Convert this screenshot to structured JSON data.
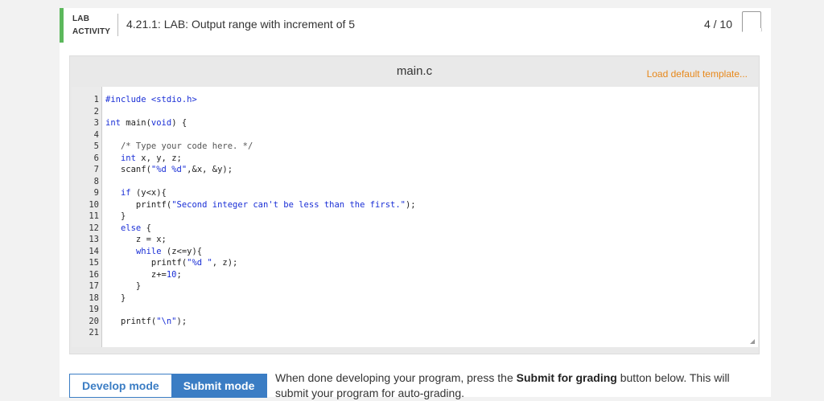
{
  "header": {
    "activity_line1": "LAB",
    "activity_line2": "ACTIVITY",
    "title": "4.21.1: LAB: Output range with increment of 5",
    "score": "4 / 10"
  },
  "editor": {
    "file_name": "main.c",
    "load_template": "Load default template...",
    "line_numbers": [
      "1",
      "2",
      "3",
      "4",
      "5",
      "6",
      "7",
      "8",
      "9",
      "10",
      "11",
      "12",
      "13",
      "14",
      "15",
      "16",
      "17",
      "18",
      "19",
      "20",
      "21"
    ],
    "lines": {
      "l1": "#include <stdio.h>",
      "l3a": "int",
      "l3b": " main(",
      "l3c": "void",
      "l3d": ") {",
      "l5": "   /* Type your code here. */",
      "l6a": "   ",
      "l6b": "int",
      "l6c": " x, y, z;",
      "l7a": "   scanf(",
      "l7b": "\"%d %d\"",
      "l7c": ",&x, &y);",
      "l9a": "   ",
      "l9b": "if",
      "l9c": " (y<x){",
      "l10a": "      printf(",
      "l10b": "\"Second integer can't be less than the first.\"",
      "l10c": ");",
      "l11": "   }",
      "l12a": "   ",
      "l12b": "else",
      "l12c": " {",
      "l13": "      z = x;",
      "l14a": "      ",
      "l14b": "while",
      "l14c": " (z<=y){",
      "l15a": "         printf(",
      "l15b": "\"%d \"",
      "l15c": ", z);",
      "l16a": "         z+=",
      "l16b": "10",
      "l16c": ";",
      "l17": "      }",
      "l18": "   }",
      "l20a": "   printf(",
      "l20b": "\"\\n\"",
      "l20c": ");"
    }
  },
  "modes": {
    "develop": "Develop mode",
    "submit": "Submit mode"
  },
  "info": {
    "prefix": "When done developing your program, press the ",
    "bold": "Submit for grading",
    "suffix": " button below. This will submit your program for auto-grading."
  }
}
